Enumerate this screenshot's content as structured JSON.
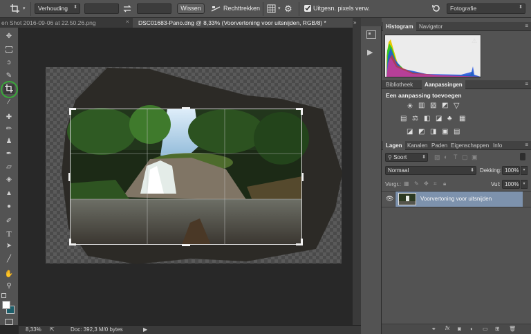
{
  "options_bar": {
    "ratio_select": "Verhouding",
    "clear_label": "Wissen",
    "straighten_label": "Rechttrekken",
    "delete_cropped_label": "Uitgesn. pixels verw.",
    "delete_cropped_checked": true,
    "workspace": "Fotografie"
  },
  "tabs": [
    {
      "label": "en Shot 2016-09-06 at 22.50.26.png",
      "active": false
    },
    {
      "label": "DSC01683-Pano.dng @ 8,33% (Voorvertoning voor uitsnijden, RGB/8) *",
      "active": true
    }
  ],
  "status": {
    "zoom": "8,33%",
    "doc": "Doc: 392,3 M/0 bytes"
  },
  "histogram_panel": {
    "tabs": [
      "Histogram",
      "Navigator"
    ],
    "warning_icon": "warning-icon"
  },
  "adjustments_panel": {
    "tabs": [
      "Bibliotheek",
      "Aanpassingen"
    ],
    "heading": "Een aanpassing toevoegen"
  },
  "layers_panel": {
    "tabs": [
      "Lagen",
      "Kanalen",
      "Paden",
      "Eigenschappen",
      "Info"
    ],
    "filter": "Soort",
    "blend_mode": "Normaal",
    "opacity_label": "Dekking:",
    "opacity": "100%",
    "lock_label": "Vergr.:",
    "fill_label": "Vul:",
    "fill": "100%",
    "layers": [
      {
        "name": "Voorvertoning voor uitsnijden",
        "visible": true,
        "selected": true
      }
    ]
  },
  "colors": {
    "accent_blue": "#4a6d96",
    "selected_layer": "#7d92ad",
    "crop_highlight": "#3aa83a"
  }
}
